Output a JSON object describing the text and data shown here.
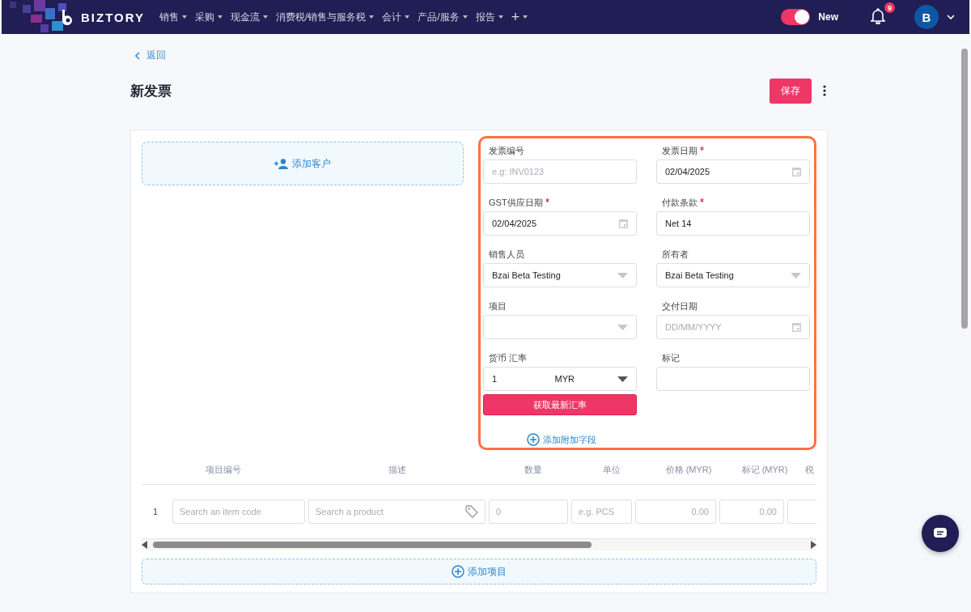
{
  "navbar": {
    "brand": "BIZTORY",
    "menu": [
      {
        "label": "销售",
        "caret": true
      },
      {
        "label": "采购",
        "caret": true
      },
      {
        "label": "现金流",
        "caret": true
      },
      {
        "label": "消费税/销售与服务税",
        "caret": true
      },
      {
        "label": "会计",
        "caret": true
      },
      {
        "label": "产品/服务",
        "caret": true
      },
      {
        "label": "报告",
        "caret": true
      },
      {
        "label": "+",
        "caret": true
      }
    ],
    "toggle": {
      "label": "New",
      "on": true
    },
    "notifications": "9",
    "avatar": "B"
  },
  "back": "返回",
  "title": "新发票",
  "save": "保存",
  "customer": {
    "label": "添加客户"
  },
  "fields": [
    {
      "kind": "text",
      "label": "发票编号",
      "required": false,
      "placeholder": "e.g: INV0123"
    },
    {
      "kind": "date",
      "label": "发票日期",
      "required": true,
      "value": "02/04/2025"
    },
    {
      "kind": "date",
      "label": "GST供应日期",
      "required": true,
      "value": "02/04/2025"
    },
    {
      "kind": "text",
      "label": "付款条款",
      "required": true,
      "value": "Net 14"
    },
    {
      "kind": "select",
      "label": "销售人员",
      "required": false,
      "value": "Bzai Beta Testing"
    },
    {
      "kind": "select",
      "label": "所有者",
      "required": false,
      "value": "Bzai Beta Testing"
    },
    {
      "kind": "select",
      "label": "项目",
      "required": false
    },
    {
      "kind": "date",
      "label": "交付日期",
      "required": false,
      "placeholder": "DD/MM/YYYY"
    },
    {
      "kind": "currency",
      "label": "货币 汇率",
      "required": false,
      "value": "1",
      "currency": "MYR"
    },
    {
      "kind": "text",
      "label": "标记",
      "required": false
    }
  ],
  "rate_button": "获取最新汇率",
  "add_field": "添加附加字段",
  "table": {
    "columns": [
      "项目编号",
      "描述",
      "数量",
      "单位",
      "价格 (MYR)",
      "标记 (MYR)",
      "税"
    ],
    "rows": [
      {
        "number": "1",
        "cells": [
          {
            "kind": "text",
            "placeholder": "Search an item code"
          },
          {
            "kind": "product",
            "placeholder": "Search a product"
          },
          {
            "kind": "text",
            "placeholder": "0"
          },
          {
            "kind": "text",
            "placeholder": "e.g. PCS"
          },
          {
            "kind": "number",
            "placeholder": "0.00"
          },
          {
            "kind": "number",
            "placeholder": "0.00"
          },
          {
            "kind": "text"
          }
        ]
      }
    ]
  },
  "add_item": "添加项目"
}
